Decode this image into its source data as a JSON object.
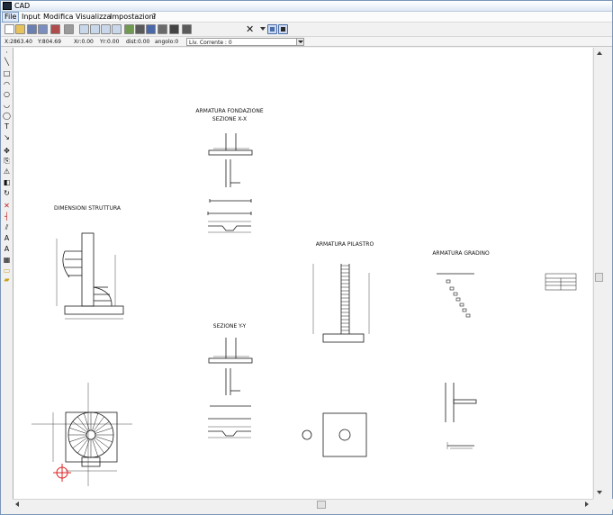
{
  "window": {
    "title": "CAD"
  },
  "menu": {
    "items": [
      {
        "label": "File"
      },
      {
        "label": "Input"
      },
      {
        "label": "Modifica"
      },
      {
        "label": "Visualizza"
      },
      {
        "label": "Impostazioni"
      },
      {
        "label": "?"
      }
    ]
  },
  "toolbar": {
    "buttons": [
      {
        "icon": "new-file-icon",
        "color": "#ffffff"
      },
      {
        "icon": "open-folder-icon",
        "color": "#e8c25a"
      },
      {
        "icon": "save-icon",
        "color": "#6b7fb0"
      },
      {
        "icon": "save-as-icon",
        "color": "#7a8fc0"
      },
      {
        "icon": "export-icon",
        "color": "#b04b4b"
      },
      {
        "icon": "print-icon",
        "color": "#9a9a9a"
      },
      {
        "icon": "zoom-in-icon",
        "color": "#c9d7ea"
      },
      {
        "icon": "zoom-out-icon",
        "color": "#c9d7ea"
      },
      {
        "icon": "zoom-window-icon",
        "color": "#c9d7ea"
      },
      {
        "icon": "zoom-extents-icon",
        "color": "#c9d7ea"
      },
      {
        "icon": "layers-icon",
        "color": "#6f9a50"
      },
      {
        "icon": "grid-icon",
        "color": "#5a5a5a"
      },
      {
        "icon": "snap-icon",
        "color": "#4a67a8"
      },
      {
        "icon": "ortho-icon",
        "color": "#6a6a6a"
      },
      {
        "icon": "grid-dots-icon",
        "color": "#444444"
      },
      {
        "icon": "table-icon",
        "color": "#5a5a5a"
      }
    ],
    "delete_symbol": "✕",
    "pressed_buttons": [
      {
        "icon": "axes-icon",
        "color": "#4a6ea9"
      },
      {
        "icon": "cursor-select-icon",
        "color": "#2a2a2a"
      }
    ]
  },
  "status": {
    "x": "X:2863.40",
    "y": "Y:804.69",
    "xr": "Xr:0.00",
    "yr": "Yr:0.00",
    "dist": "dist:0.00",
    "angolo": "angolo:0",
    "livello": "Liv. Corrente : 0"
  },
  "left_tools": [
    {
      "icon": "point-icon",
      "glyph": "·"
    },
    {
      "icon": "line-icon",
      "glyph": "╲"
    },
    {
      "icon": "rectangle-icon",
      "glyph": "□"
    },
    {
      "icon": "arc-icon",
      "glyph": "◠"
    },
    {
      "icon": "circle-icon",
      "glyph": "○"
    },
    {
      "icon": "arc3-icon",
      "glyph": "◡"
    },
    {
      "icon": "ellipse-icon",
      "glyph": "◯"
    },
    {
      "icon": "text-icon",
      "glyph": "T"
    },
    {
      "icon": "dimension-icon",
      "glyph": "↘"
    },
    {
      "icon": "move-icon",
      "glyph": "✥"
    },
    {
      "icon": "copy-icon",
      "glyph": "⎘"
    },
    {
      "icon": "mirror-icon",
      "glyph": "⚠"
    },
    {
      "icon": "scale-icon",
      "glyph": "◧"
    },
    {
      "icon": "rotate-icon",
      "glyph": "↻"
    },
    {
      "icon": "erase-icon",
      "glyph": "✕"
    },
    {
      "icon": "trim-icon",
      "glyph": "┤"
    },
    {
      "icon": "offset-icon",
      "glyph": "⫽"
    },
    {
      "icon": "dim-align-icon",
      "glyph": "A"
    },
    {
      "icon": "dim-text-icon",
      "glyph": "A"
    },
    {
      "icon": "hatch-icon",
      "glyph": "▦"
    },
    {
      "icon": "block-icon",
      "glyph": "▭"
    },
    {
      "icon": "paint-icon",
      "glyph": "▰"
    },
    {
      "icon": "attributes-icon",
      "glyph": "⚙"
    }
  ],
  "drawing": {
    "labels": {
      "fondazione_1": "ARMATURA FONDAZIONE",
      "fondazione_2": "SEZIONE X-X",
      "dimensioni": "DIMENSIONI STRUTTURA",
      "pilastro": "ARMATURA PILASTRO",
      "gradino": "ARMATURA GRADINO",
      "sezione_yy": "SEZIONE Y-Y"
    },
    "line_color": "#1a1a1a",
    "cursor_color": "#e02020"
  }
}
